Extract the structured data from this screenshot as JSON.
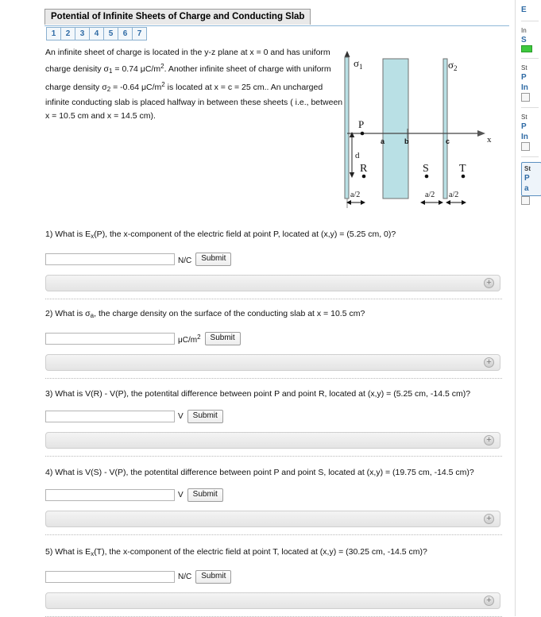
{
  "header": {
    "title": "Potential of Infinite Sheets of Charge and Conducting Slab",
    "tabs": [
      "1",
      "2",
      "3",
      "4",
      "5",
      "6",
      "7"
    ]
  },
  "statement": {
    "line1_a": "An infinite sheet of charge is located in the y-z plane at x = 0 and has uniform charge denisity σ",
    "line1_sub": "1",
    "line1_b": " = 0.74 μC/m",
    "line1_sup": "2",
    "line1_c": ". Another infinite sheet of charge with uniform charge density σ",
    "line2_sub": "2",
    "line2_b": " = -0.64 μC/m",
    "line2_sup": "2",
    "line2_c": " is located at x = c = 25 cm.. An uncharged infinite conducting slab is placed halfway in between these sheets ( i.e., between x = 10.5 cm and x = 14.5 cm)."
  },
  "figure": {
    "label_sigma1": "σ",
    "label_sigma1_sub": "1",
    "label_sigma2": "σ",
    "label_sigma2_sub": "2",
    "label_x_axis": "x",
    "label_P": "P",
    "label_R": "R",
    "label_S": "S",
    "label_T": "T",
    "label_a": "a",
    "label_b": "b",
    "label_c": "c",
    "label_d": "d",
    "label_a_half_1": "a/2",
    "label_a_half_2": "a/2",
    "label_a_half_3": "a/2",
    "slab_color": "#b9e0e5",
    "sheet_color": "#b9e0e5",
    "line_color": "#444444"
  },
  "questions": [
    {
      "num": "1)",
      "text_a": "1) What is E",
      "text_sub": "x",
      "text_b": "(P), the x-component of the electric field at point P, located at (x,y) = (5.25 cm, 0)?",
      "value": "",
      "placeholder": "",
      "unit_a": "N/C",
      "unit_sup": "",
      "submit_label": "Submit"
    },
    {
      "num": "2)",
      "text_a": "2) What is σ",
      "text_sub": "a",
      "text_b": ", the charge density on the surface of the conducting slab at x = 10.5 cm?",
      "value": "",
      "placeholder": "",
      "unit_a": "μC/m",
      "unit_sup": "2",
      "submit_label": "Submit"
    },
    {
      "num": "3)",
      "text_a": "3) What is V(R) - V(P), the potentital difference between point P and point R, located at (x,y) = (5.25 cm, -14.5 cm)?",
      "text_sub": "",
      "text_b": "",
      "value": "",
      "placeholder": "",
      "unit_a": "V",
      "unit_sup": "",
      "submit_label": "Submit"
    },
    {
      "num": "4)",
      "text_a": "4) What is V(S) - V(P), the potentital difference between point P and point S, located at (x,y) = (19.75 cm, -14.5 cm)?",
      "text_sub": "",
      "text_b": "",
      "value": "",
      "placeholder": "",
      "unit_a": "V",
      "unit_sup": "",
      "submit_label": "Submit"
    },
    {
      "num": "5)",
      "text_a": "5) What is E",
      "text_sub": "x",
      "text_b": "(T), the x-component of the electric field at point T, located at (x,y) = (30.25 cm, -14.5 cm)?",
      "value": "",
      "placeholder": "",
      "unit_a": "N/C",
      "unit_sup": "",
      "submit_label": "Submit"
    }
  ],
  "sidebar": {
    "item1_link": "E",
    "item2_label": "In",
    "item2_link": "S",
    "item3_label": "St",
    "item3_link": "P",
    "item3_link2": "In",
    "item4_label": "St",
    "item4_link": "P",
    "item4_link2": "In",
    "item5_label": "St",
    "item5_link": "P",
    "item5_link2": "a"
  },
  "colors": {
    "accent": "#2f6ba5",
    "title_bg": "#e9e9e9",
    "slab": "#b9e0e5"
  }
}
